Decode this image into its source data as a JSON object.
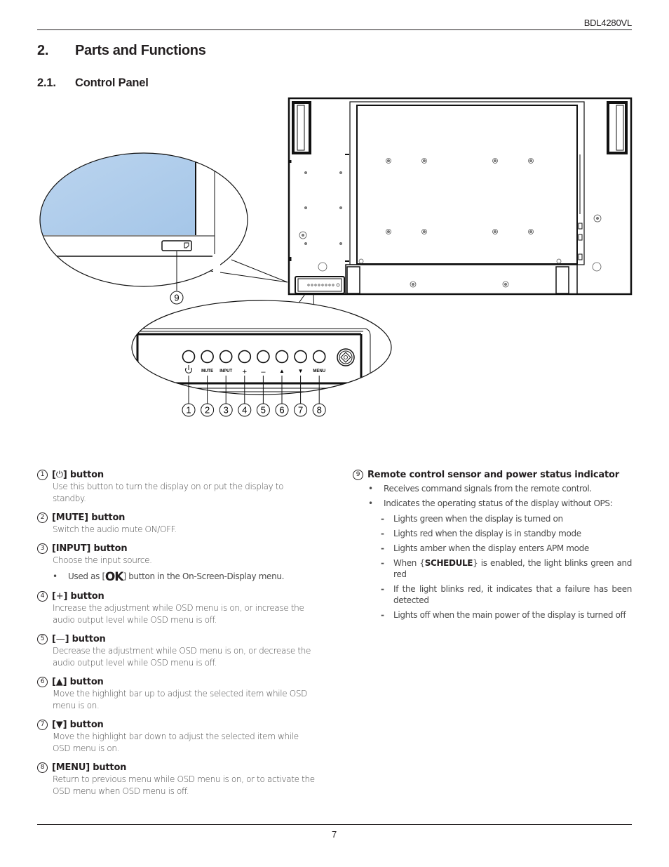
{
  "header": {
    "model": "BDL4280VL"
  },
  "section": {
    "number": "2.",
    "title": "Parts and Functions"
  },
  "subsection": {
    "number": "2.1.",
    "title": "Control Panel"
  },
  "figure": {
    "callout_sensor": "9",
    "panel_labels": [
      "",
      "MUTE",
      "INPUT",
      "+",
      "–",
      "▲",
      "▼",
      "MENU"
    ],
    "panel_numbers": [
      "1",
      "2",
      "3",
      "4",
      "5",
      "6",
      "7",
      "8"
    ],
    "screen_color": "#a9c9ea"
  },
  "items": [
    {
      "num": "1",
      "prefix": "[",
      "symbol": "⏻",
      "suffix": "] button",
      "desc": "Use this button to turn the display on or put the display to standby."
    },
    {
      "num": "2",
      "title": "[MUTE] button",
      "desc": "Switch the audio mute ON/OFF."
    },
    {
      "num": "3",
      "title": "[INPUT] button",
      "desc": "Choose the input source.",
      "bullet_prefix": "Used as [",
      "bullet_glyph": "OK",
      "bullet_suffix": "] button in the On-Screen-Display menu."
    },
    {
      "num": "4",
      "prefix": "[",
      "symbol": "+",
      "suffix": "] button",
      "desc": "Increase the adjustment while OSD menu is on, or increase the audio output level while OSD menu is off."
    },
    {
      "num": "5",
      "prefix": "[",
      "symbol": "—",
      "suffix": "] button",
      "desc": "Decrease the adjustment while OSD menu is on, or decrease the audio output level while OSD menu is off."
    },
    {
      "num": "6",
      "prefix": "[",
      "symbol": "▲",
      "suffix": "] button",
      "desc": "Move the highlight bar up to adjust the selected item while OSD menu is on."
    },
    {
      "num": "7",
      "prefix": "[",
      "symbol": "▼",
      "suffix": "] button",
      "desc": "Move the highlight bar down to adjust the selected item while OSD menu is on."
    },
    {
      "num": "8",
      "title": "[MENU] button",
      "desc": "Return to previous menu while OSD menu is on, or to activate the OSD menu when OSD menu is off."
    }
  ],
  "sensor": {
    "num": "9",
    "title": "Remote control sensor and power status indicator",
    "bullets": [
      "Receives command signals from the remote control.",
      "Indicates the operating status of the display without OPS:"
    ],
    "states": [
      "Lights green when the display is turned on",
      "Lights red when the display is in standby mode",
      "Lights amber when the display enters APM mode",
      "If the light blinks red, it indicates that a failure has been detected",
      "Lights off when the main power of the display is turned off"
    ],
    "schedule_prefix": "When {",
    "schedule_keyword": "SCHEDULE",
    "schedule_suffix": "} is enabled, the light blinks green and red"
  },
  "footer": {
    "page_number": "7"
  }
}
